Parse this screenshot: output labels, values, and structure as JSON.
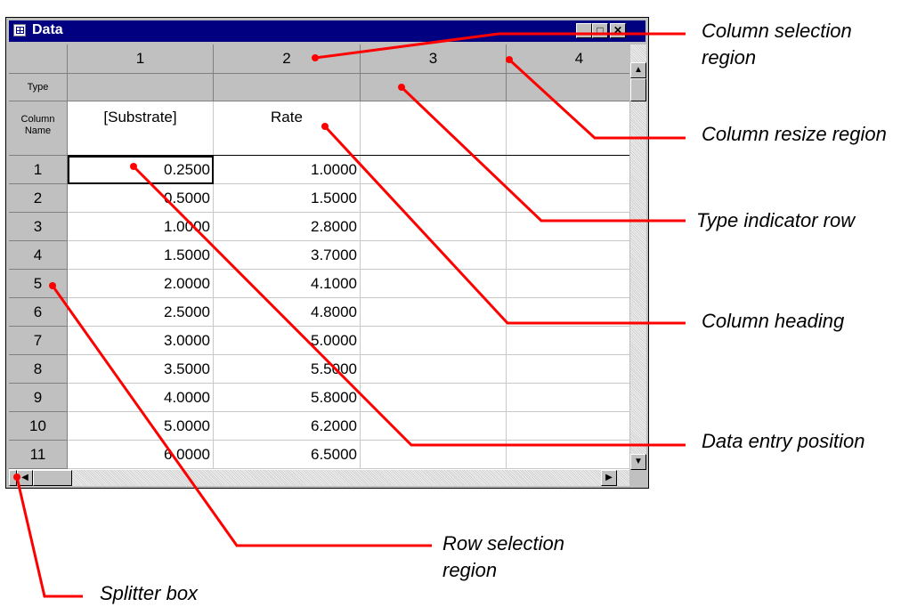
{
  "window": {
    "title": "Data"
  },
  "columns": [
    "1",
    "2",
    "3",
    "4"
  ],
  "header_rows": {
    "type_label": "Type",
    "name_label": "Column Name"
  },
  "column_names": [
    "[Substrate]",
    "Rate",
    "",
    ""
  ],
  "rows": [
    {
      "n": "1",
      "substrate": "0.2500",
      "rate": "1.0000"
    },
    {
      "n": "2",
      "substrate": "0.5000",
      "rate": "1.5000"
    },
    {
      "n": "3",
      "substrate": "1.0000",
      "rate": "2.8000"
    },
    {
      "n": "4",
      "substrate": "1.5000",
      "rate": "3.7000"
    },
    {
      "n": "5",
      "substrate": "2.0000",
      "rate": "4.1000"
    },
    {
      "n": "6",
      "substrate": "2.5000",
      "rate": "4.8000"
    },
    {
      "n": "7",
      "substrate": "3.0000",
      "rate": "5.0000"
    },
    {
      "n": "8",
      "substrate": "3.5000",
      "rate": "5.5000"
    },
    {
      "n": "9",
      "substrate": "4.0000",
      "rate": "5.8000"
    },
    {
      "n": "10",
      "substrate": "5.0000",
      "rate": "6.2000"
    },
    {
      "n": "11",
      "substrate": "6.0000",
      "rate": "6.5000"
    }
  ],
  "annotations": {
    "column_selection": "Column selection region",
    "column_resize": "Column resize region",
    "type_indicator": "Type indicator row",
    "column_heading": "Column heading",
    "data_entry": "Data entry position",
    "row_selection": "Row selection region",
    "splitter": "Splitter box"
  },
  "colors": {
    "title_bar": "#000080",
    "callout": "#ff0000",
    "chrome": "#c0c0c0"
  }
}
